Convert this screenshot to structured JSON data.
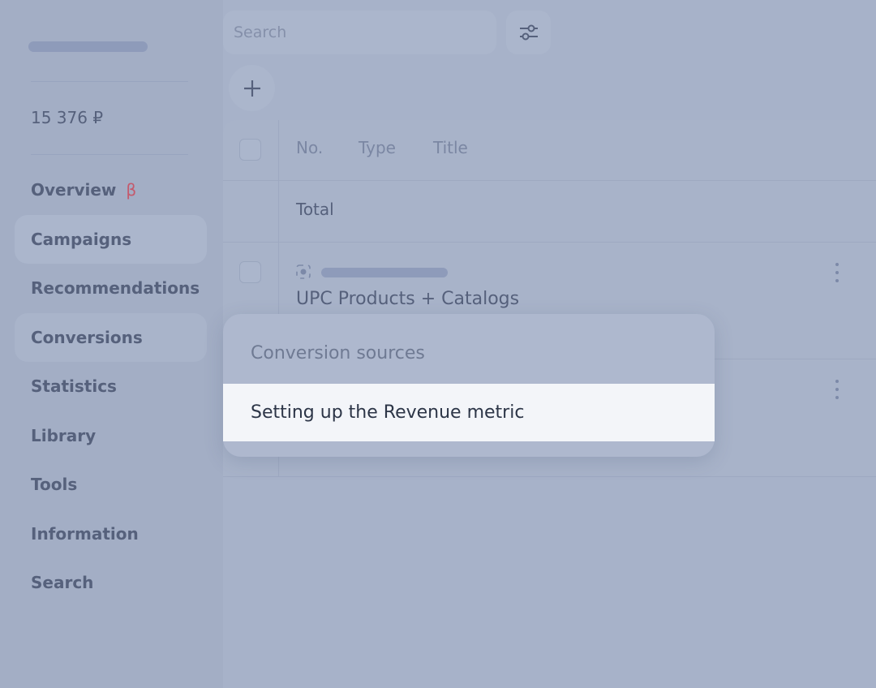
{
  "sidebar": {
    "balance": "15 376 ₽",
    "items": [
      {
        "label": "Overview",
        "badge": "β"
      },
      {
        "label": "Campaigns"
      },
      {
        "label": "Recommendations"
      },
      {
        "label": "Conversions"
      },
      {
        "label": "Statistics"
      },
      {
        "label": "Library"
      },
      {
        "label": "Tools"
      },
      {
        "label": "Information"
      },
      {
        "label": "Search"
      }
    ]
  },
  "toolbar": {
    "search_placeholder": "Search",
    "filter_icon": "sliders-icon",
    "add_icon": "plus-icon"
  },
  "table": {
    "columns": [
      "No.",
      "Type",
      "Title"
    ],
    "total_label": "Total",
    "rows": [
      {
        "name": "UPC Products + Catalogs",
        "icon": "target-icon"
      }
    ]
  },
  "popup": {
    "title": "Conversion sources",
    "items": [
      "Setting up the Revenue metric"
    ]
  },
  "colors": {
    "overlay_bg": "#a7b2c9",
    "text": "#56617c",
    "beta_badge": "#c45a6d",
    "highlight_item_bg": "#f3f5f9"
  }
}
